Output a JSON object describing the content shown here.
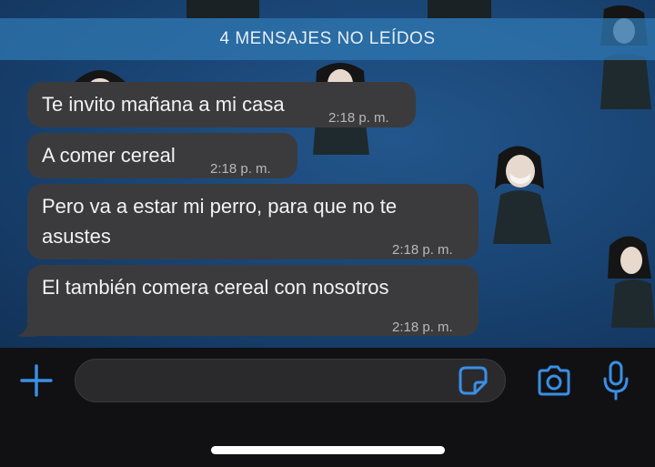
{
  "banner": {
    "unread_label": "4 MENSAJES NO LEÍDOS"
  },
  "messages": [
    {
      "text": "Te invito mañana a mi casa",
      "time": "2:18 p. m."
    },
    {
      "text": "A comer cereal",
      "time": "2:18 p. m."
    },
    {
      "text": "Pero va a estar mi perro, para que no te",
      "text2": "asustes",
      "time": "2:18 p. m."
    },
    {
      "text": "El también comera cereal con nosotros",
      "time": "2:18 p. m."
    }
  ],
  "composer": {
    "input_value": "",
    "placeholder": ""
  },
  "icons": {
    "add": "plus-icon",
    "sticker": "sticker-icon",
    "camera": "camera-icon",
    "mic": "microphone-icon"
  },
  "colors": {
    "accent": "#3a8fe6",
    "bubble": "#3b3b3e",
    "banner": "#2e76b0",
    "composer_bg": "#111113",
    "wallpaper": "#1a4676"
  }
}
